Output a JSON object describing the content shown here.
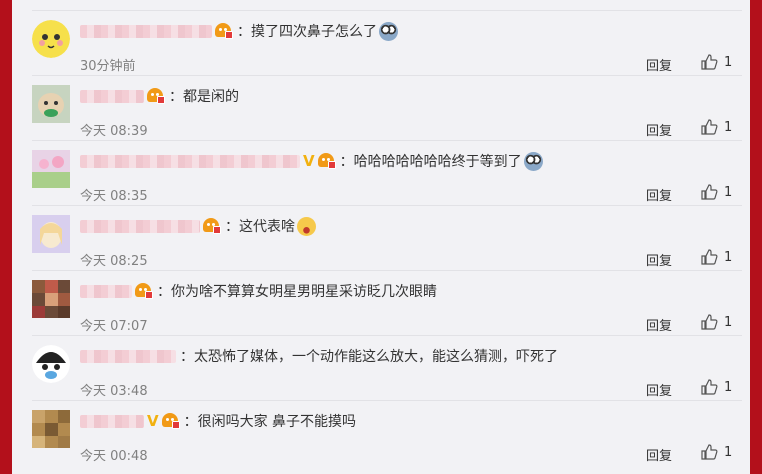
{
  "colors": {
    "border": "#b3101b",
    "panel": "#f2f2f5",
    "name_blur": "#f3c9d0",
    "text": "#333333",
    "meta": "#808080",
    "vip": "#f2b10f"
  },
  "comments": [
    {
      "text": "：摸了四次鼻子怎么了",
      "emoji": "face-blue",
      "time": "30分钟前",
      "reply": "回复",
      "likes": "1",
      "vip": false
    },
    {
      "text": "：都是闲的",
      "emoji": "",
      "time": "今天 08:39",
      "reply": "回复",
      "likes": "1",
      "vip": false
    },
    {
      "text": "：哈哈哈哈哈哈哈终于等到了",
      "emoji": "face-blue",
      "time": "今天 08:35",
      "reply": "回复",
      "likes": "1",
      "vip": true
    },
    {
      "text": "：这代表啥",
      "emoji": "face-smile",
      "time": "今天 08:25",
      "reply": "回复",
      "likes": "1",
      "vip": false
    },
    {
      "text": "：你为啥不算算女明星男明星采访眨几次眼睛",
      "emoji": "",
      "time": "今天 07:07",
      "reply": "回复",
      "likes": "1",
      "vip": false
    },
    {
      "text": "：太恐怖了媒体，一个动作能这么放大，能这么猜测，吓死了",
      "emoji": "",
      "time": "今天 03:48",
      "reply": "回复",
      "likes": "1",
      "vip": false
    },
    {
      "text": "：很闲吗大家 鼻子不能摸吗",
      "emoji": "",
      "time": "今天 00:48",
      "reply": "回复",
      "likes": "1",
      "vip": true
    }
  ]
}
